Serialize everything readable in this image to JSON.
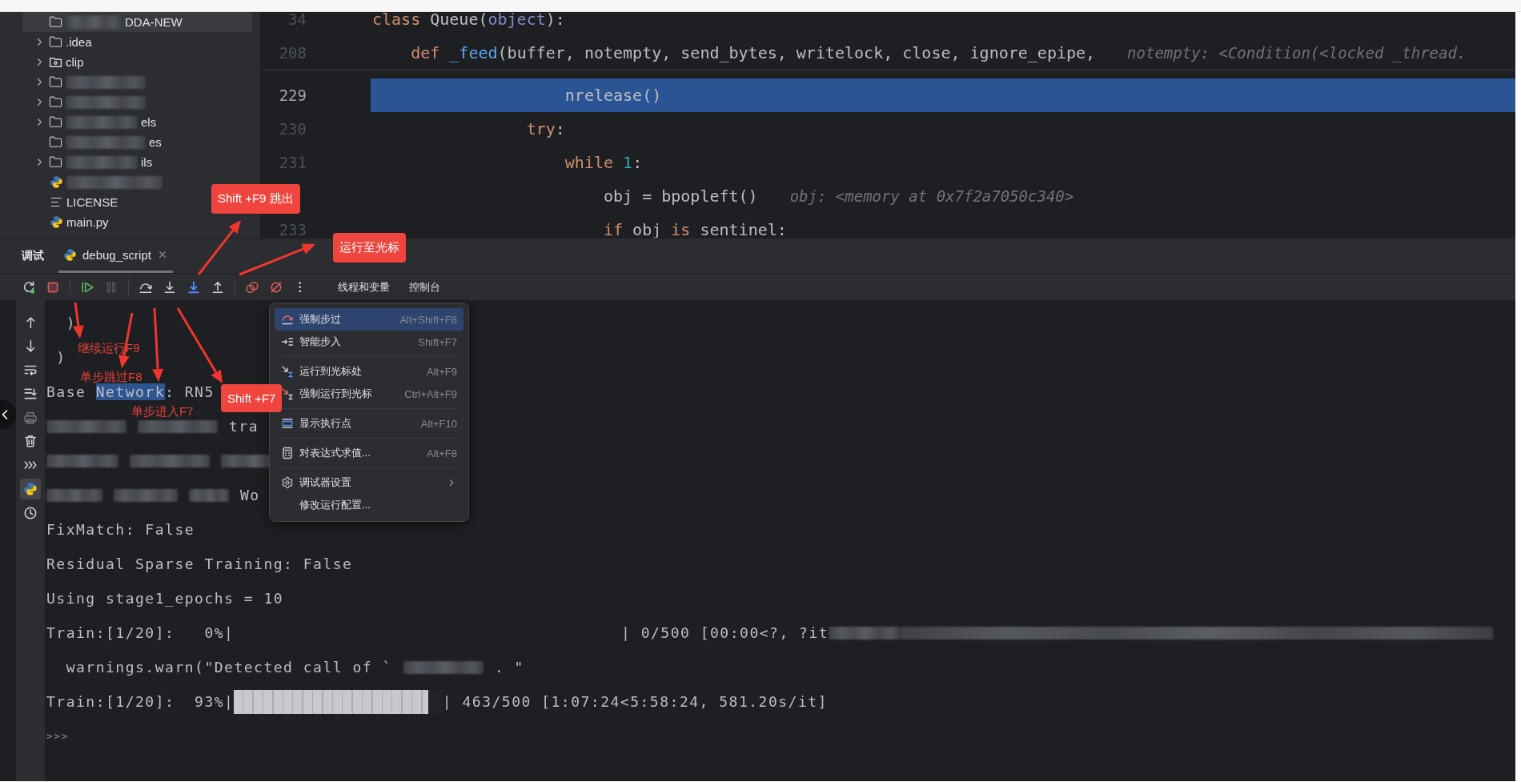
{
  "project_tree": {
    "items": [
      {
        "kind": "folder",
        "label": "DDA-NEW",
        "redacted": true,
        "selected": true
      },
      {
        "kind": "folder",
        "label": ".idea",
        "redacted": false,
        "expanded": false,
        "selected": false
      },
      {
        "kind": "package",
        "label": "clip",
        "redacted": false,
        "expanded": false,
        "selected": false
      },
      {
        "kind": "folder",
        "redacted": true,
        "expanded": false,
        "selected": false
      },
      {
        "kind": "folder",
        "redacted": true,
        "expanded": false,
        "selected": false
      },
      {
        "kind": "folder",
        "label": "els",
        "redacted": true,
        "expanded": false,
        "selected": false
      },
      {
        "kind": "folder",
        "label": "es",
        "redacted": true,
        "selected": false
      },
      {
        "kind": "folder",
        "label": "ils",
        "redacted": true,
        "expanded": false,
        "selected": false
      },
      {
        "kind": "python",
        "redacted": true,
        "selected": false
      },
      {
        "kind": "text",
        "label": "LICENSE",
        "redacted": false,
        "selected": false
      },
      {
        "kind": "python",
        "label": "main.py",
        "redacted": false,
        "selected": false
      }
    ]
  },
  "editor": {
    "sticky_lines": [
      {
        "number": "34",
        "segments": [
          {
            "kind": "keyword",
            "text": "class "
          },
          {
            "kind": "plain",
            "text": "Queue("
          },
          {
            "kind": "builtin",
            "text": "object"
          },
          {
            "kind": "plain",
            "text": "):"
          }
        ],
        "selected": false
      },
      {
        "number": "208",
        "segments": [
          {
            "kind": "keyword",
            "text": "    def "
          },
          {
            "kind": "function",
            "text": "_feed"
          },
          {
            "kind": "plain",
            "text": "(buffer, notempty, send_bytes, writelock, close, ignore_epipe,"
          }
        ],
        "hint": "notempty: <Condition(<locked _thread.",
        "selected": false
      }
    ],
    "lines": [
      {
        "number": "229",
        "segments": [
          {
            "kind": "plain",
            "text": "                    nrelease()"
          }
        ],
        "selected": true
      },
      {
        "number": "230",
        "segments": [
          {
            "kind": "keyword",
            "text": "                try"
          },
          {
            "kind": "plain",
            "text": ":"
          }
        ],
        "selected": false
      },
      {
        "number": "231",
        "segments": [
          {
            "kind": "keyword",
            "text": "                    while "
          },
          {
            "kind": "number",
            "text": "1"
          },
          {
            "kind": "plain",
            "text": ":"
          }
        ],
        "selected": false
      },
      {
        "segments": [
          {
            "kind": "plain",
            "text": "                        obj = bpopleft()"
          }
        ],
        "hint": "obj: <memory at 0x7f2a7050c340>",
        "selected": false
      },
      {
        "number": "233",
        "segments": [
          {
            "kind": "keyword",
            "text": "                        if"
          },
          {
            "kind": "plain",
            "text": " obj "
          },
          {
            "kind": "keyword",
            "text": "is"
          },
          {
            "kind": "plain",
            "text": " sentinel:"
          }
        ],
        "selected": false
      }
    ]
  },
  "tool_window": {
    "title": "调试",
    "tabs": [
      {
        "label": "debug_script",
        "selected": true
      }
    ]
  },
  "toolbar": {
    "buttons": [
      {
        "kind": "rerun",
        "disabled": false
      },
      {
        "kind": "stop",
        "disabled": false
      },
      {
        "kind": "separator"
      },
      {
        "kind": "resume",
        "disabled": false
      },
      {
        "kind": "pause",
        "disabled": true
      },
      {
        "kind": "separator"
      },
      {
        "kind": "step-over",
        "disabled": false
      },
      {
        "kind": "step-into",
        "disabled": false
      },
      {
        "kind": "smart-step-into",
        "disabled": false
      },
      {
        "kind": "step-out",
        "disabled": false
      },
      {
        "kind": "separator"
      },
      {
        "kind": "view-breakpoints",
        "disabled": false
      },
      {
        "kind": "mute-breakpoints",
        "disabled": false
      },
      {
        "kind": "more",
        "disabled": false
      }
    ],
    "tabs": [
      {
        "label": "线程和变量"
      },
      {
        "label": "控制台"
      }
    ]
  },
  "console_sidebar": {
    "buttons": [
      {
        "kind": "up",
        "disabled": false,
        "selected": false
      },
      {
        "kind": "down",
        "disabled": false,
        "selected": false
      },
      {
        "kind": "wrap",
        "disabled": false,
        "selected": false
      },
      {
        "kind": "scroll-end",
        "disabled": false,
        "selected": false
      },
      {
        "kind": "print",
        "disabled": true,
        "selected": false
      },
      {
        "kind": "trash",
        "disabled": false,
        "selected": false
      },
      {
        "kind": "chevrons",
        "disabled": false,
        "selected": false
      },
      {
        "kind": "python",
        "disabled": false,
        "selected": true
      },
      {
        "kind": "history",
        "disabled": false,
        "selected": false
      }
    ]
  },
  "console": {
    "lines": [
      {
        "kind": "text",
        "segments": [
          {
            "kind": "text",
            "text": "  )"
          }
        ]
      },
      {
        "kind": "text",
        "segments": [
          {
            "kind": "text",
            "text": " )"
          }
        ]
      },
      {
        "kind": "text",
        "segments": [
          {
            "kind": "text",
            "text": "Base "
          },
          {
            "kind": "text",
            "text": "Network",
            "selected": true
          },
          {
            "kind": "text",
            "text": ": RN5"
          }
        ]
      },
      {
        "kind": "text",
        "segments": [
          {
            "kind": "blur"
          },
          {
            "kind": "blur"
          },
          {
            "kind": "text",
            "text": "tra"
          }
        ]
      },
      {
        "kind": "text",
        "segments": [
          {
            "kind": "blur"
          },
          {
            "kind": "blur"
          },
          {
            "kind": "blur"
          }
        ]
      },
      {
        "kind": "text",
        "segments": [
          {
            "kind": "blur"
          },
          {
            "kind": "blur"
          },
          {
            "kind": "blur"
          },
          {
            "kind": "text",
            "text": "Wo"
          }
        ]
      },
      {
        "kind": "text",
        "segments": [
          {
            "kind": "text",
            "text": "FixMatch: False"
          }
        ]
      },
      {
        "kind": "text",
        "segments": [
          {
            "kind": "text",
            "text": "Residual Sparse Training: False"
          }
        ]
      },
      {
        "kind": "text",
        "segments": [
          {
            "kind": "text",
            "text": "Using stage1_epochs = 10"
          }
        ]
      },
      {
        "kind": "progress",
        "prefix": "Train:[1/20]:   0%|",
        "suffix": "| 0/500 [00:00<?, ?it",
        "trailing": [
          {
            "kind": "blur"
          }
        ]
      },
      {
        "kind": "text",
        "segments": [
          {
            "kind": "text",
            "text": "  warnings.warn(\"Detected call of `"
          },
          {
            "kind": "blur"
          },
          {
            "kind": "text",
            "text": ". \""
          }
        ]
      },
      {
        "kind": "progress",
        "prefix": "Train:[1/20]:  93%|",
        "level": 0.93,
        "suffix": "| 463/500 [1:07:24<5:58:24, 581.20s/it]"
      },
      {
        "kind": "prompt",
        "segments": [
          {
            "kind": "text",
            "text": ">>>"
          }
        ]
      }
    ]
  },
  "context_menu": {
    "groups": [
      {
        "items": [
          {
            "kind": "force-step-over",
            "label": "强制步过",
            "shortcut": "Alt+Shift+F8",
            "selected": true
          },
          {
            "kind": "smart-step-into",
            "label": "智能步入",
            "shortcut": "Shift+F7",
            "selected": false
          }
        ]
      },
      {
        "items": [
          {
            "kind": "run-to-cursor",
            "label": "运行到光标处",
            "shortcut": "Alt+F9",
            "selected": false
          },
          {
            "kind": "force-run-to-cursor",
            "label": "强制运行到光标",
            "shortcut": "Ctrl+Alt+F9",
            "selected": false
          }
        ]
      },
      {
        "items": [
          {
            "kind": "execution-point",
            "label": "显示执行点",
            "shortcut": "Alt+F10",
            "selected": false
          }
        ]
      },
      {
        "items": [
          {
            "kind": "calculator",
            "label": "对表达式求值...",
            "shortcut": "Alt+F8",
            "selected": false
          }
        ]
      },
      {
        "items": [
          {
            "kind": "settings",
            "label": "调试器设置",
            "submenu": true,
            "selected": false
          },
          {
            "label": "修改运行配置...",
            "submenu": false,
            "selected": false
          }
        ]
      }
    ]
  },
  "annotations": {
    "callouts": [
      {
        "text": "Shift +F9 跳出"
      },
      {
        "text": "运行至光标"
      },
      {
        "text": "Shift +F7"
      }
    ],
    "notes": [
      {
        "text": "继续运行F9"
      },
      {
        "text": "单步跳过F8"
      },
      {
        "text": "单步进入F7"
      }
    ]
  }
}
